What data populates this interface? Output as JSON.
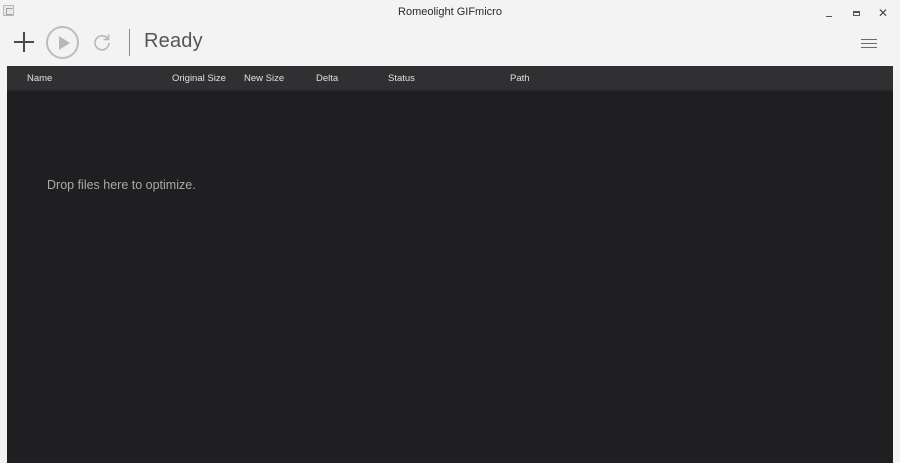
{
  "window": {
    "title": "Romeolight GIFmicro",
    "close_glyph": "✕"
  },
  "toolbar": {
    "status": "Ready",
    "icons": [
      "plus-icon",
      "play-icon",
      "refresh-icon",
      "hamburger-menu-icon"
    ]
  },
  "table": {
    "columns": [
      "Name",
      "Original Size",
      "New Size",
      "Delta",
      "Status",
      "Path"
    ],
    "empty_message": "Drop files here to optimize."
  },
  "colors": {
    "background": "#f3f3f3",
    "table_bg": "#1f1f21",
    "header_bg": "#303032",
    "header_text": "#e0e0e0",
    "hint_text": "#a9a9a9"
  }
}
